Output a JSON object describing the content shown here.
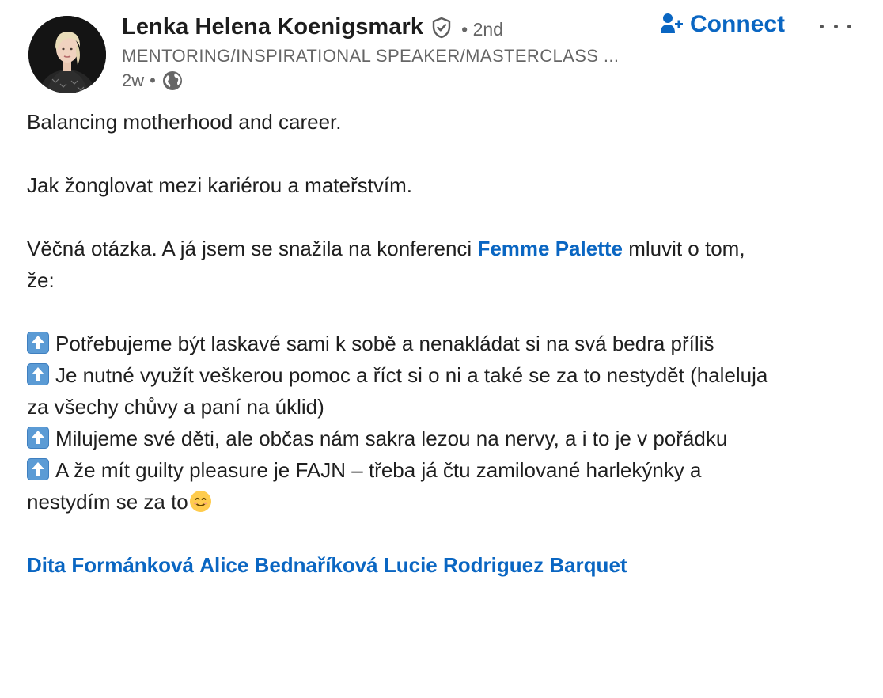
{
  "author": {
    "name": "Lenka Helena Koenigsmark",
    "degree": "• 2nd",
    "headline": "MENTORING/INSPIRATIONAL SPEAKER/MASTERCLASS ...",
    "time": "2w",
    "dot": "•",
    "visibility_icon": "globe-icon",
    "verified_icon": "verified-shield-icon"
  },
  "actions": {
    "connect_label": "Connect",
    "connect_icon": "add-person-icon",
    "more_icon": "more-options-icon"
  },
  "post": {
    "line1": "Balancing motherhood and career.",
    "line2": "Jak žonglovat mezi kariérou a mateřstvím.",
    "line3_before": "Věčná otázka. A já jsem se snažila na konferenci ",
    "line3_link": "Femme Palette",
    "line3_after": " mluvit o tom,",
    "line3_cont": "že:",
    "bullets": [
      "Potřebujeme být laskavé sami k sobě a nenakládat si na svá bedra příliš",
      "Je nutné využít veškerou pomoc a říct si o ni a také se za to nestydět (haleluja",
      "Milujeme své děti, ale občas nám sakra lezou na nervy, a i to je v pořádku",
      "A že mít guilty pleasure je FAJN – třeba já čtu zamilované harlekýnky a"
    ],
    "bullet2_cont": "za všechy chůvy a paní na úklid)",
    "bullet4_cont": "nestydím se za to",
    "bullet_icon": "up-arrow-emoji-icon",
    "end_emoji": "smiling-face-emoji-icon",
    "mentions": [
      "Dita Formánková",
      "Alice Bednaříková",
      "Lucie Rodriguez Barquet"
    ]
  },
  "colors": {
    "link": "#0a66c2",
    "text": "#1f1f1f",
    "muted": "#666666"
  }
}
